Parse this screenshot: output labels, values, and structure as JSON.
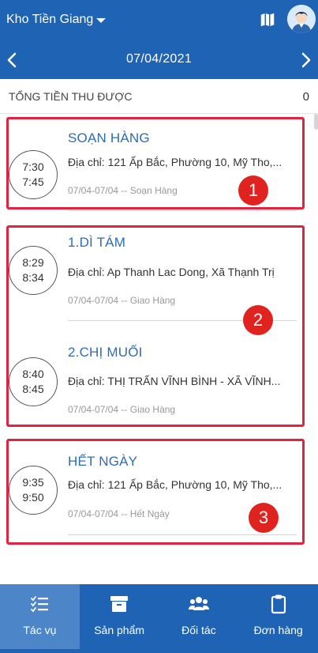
{
  "header": {
    "warehouse_name": "Kho Tiền Giang",
    "date": "07/04/2021",
    "icons": {
      "dropdown": "caret-down-icon",
      "map": "map-icon",
      "avatar": "user-avatar",
      "prev": "chevron-left-icon",
      "next": "chevron-right-icon"
    }
  },
  "summary": {
    "label": "TỔNG TIỀN THU ĐƯỢC",
    "value": "0"
  },
  "tasks": [
    {
      "start": "7:30",
      "end": "7:45",
      "title": "SOẠN HÀNG",
      "address": "Địa chỉ: 121 Ấp Bắc, Phường 10, Mỹ Tho,...",
      "meta": "07/04-07/04 -- Soạn Hàng"
    },
    {
      "start": "8:29",
      "end": "8:34",
      "title": "1.DÌ TÁM",
      "address": "Địa chỉ: Ap Thanh Lac Dong, Xã Thạnh Trị",
      "meta": "07/04-07/04 -- Giao Hàng"
    },
    {
      "start": "8:40",
      "end": "8:45",
      "title": "2.CHỊ  MUỐI",
      "address": "Địa chỉ: THỊ TRẤN VĨNH BÌNH - XÃ VĨNH...",
      "meta": "07/04-07/04 -- Giao Hàng"
    },
    {
      "start": "9:35",
      "end": "9:50",
      "title": "HẾT NGÀY",
      "address": "Địa chỉ: 121 Ấp Bắc, Phường 10, Mỹ Tho,...",
      "meta": "07/04-07/04 -- Hết Ngày"
    }
  ],
  "annotations": {
    "badge_1": "1",
    "badge_2": "2",
    "badge_3": "3",
    "highlight_color": "#e2223f"
  },
  "nav": {
    "items": [
      {
        "label": "Tác vụ",
        "icon": "task-list-icon",
        "active": true
      },
      {
        "label": "Sản phẩm",
        "icon": "archive-box-icon",
        "active": false
      },
      {
        "label": "Đối tác",
        "icon": "users-icon",
        "active": false
      },
      {
        "label": "Đơn hàng",
        "icon": "clipboard-icon",
        "active": false
      }
    ]
  },
  "colors": {
    "primary": "#1e63b4",
    "active_tab": "#4d86c8",
    "title_blue": "#2e6db4"
  }
}
